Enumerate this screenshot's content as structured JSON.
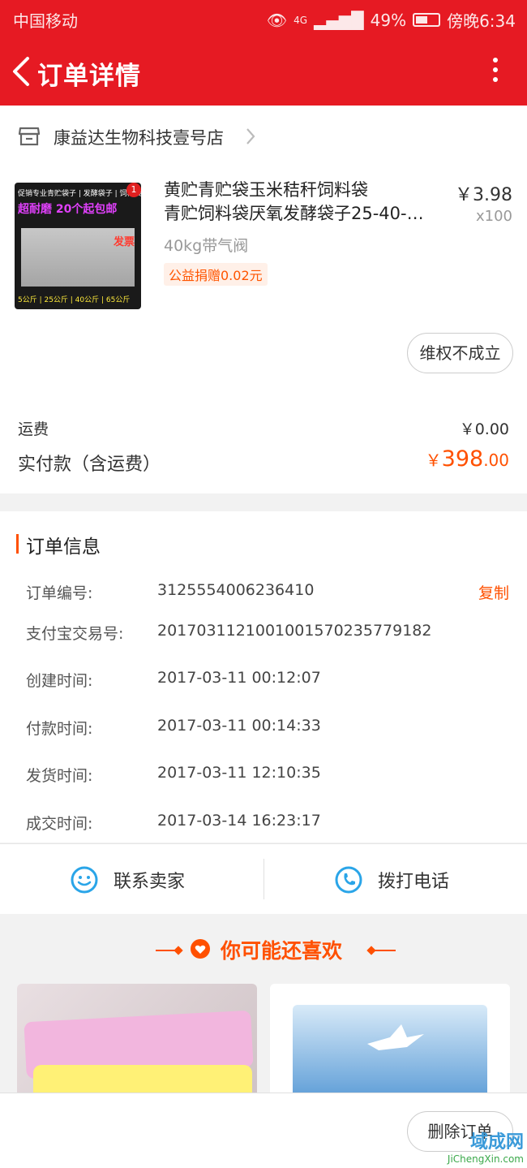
{
  "status_bar": {
    "carrier": "中国移动",
    "network": "4G",
    "battery": "49%",
    "time": "傍晚6:34"
  },
  "header": {
    "title": "订单详情"
  },
  "shop": {
    "name": "康益达生物科技壹号店"
  },
  "product": {
    "title_line1": "黄贮青贮袋玉米秸秆饲料袋",
    "title_line2": "青贮饲料袋厌氧发酵袋子25-40-…",
    "sku": "40kg带气阀",
    "charity_tag": "公益捐赠0.02元",
    "price": "￥3.98",
    "quantity": "x100",
    "image_text": {
      "top": "促销专业青贮袋子 | 发酵袋子 | 饲料袋",
      "promo": "超耐磨 20个起包邮",
      "invoice": "发票",
      "sizes": "5公斤 | 25公斤 | 40公斤 | 65公斤",
      "badge": "1"
    },
    "rights_button": "维权不成立"
  },
  "payment": {
    "freight_label": "运费",
    "freight_value": "￥0.00",
    "total_label": "实付款（含运费）",
    "total_currency": "￥",
    "total_int": "398",
    "total_dec": ".00"
  },
  "order_info": {
    "title": "订单信息",
    "copy_label": "复制",
    "rows": [
      {
        "label": "订单编号:",
        "value": "3125554006236410"
      },
      {
        "label": "支付宝交易号:",
        "value": "2017031121001001570235779182"
      },
      {
        "label": "创建时间:",
        "value": "2017-03-11 00:12:07"
      },
      {
        "label": "付款时间:",
        "value": "2017-03-11 00:14:33"
      },
      {
        "label": "发货时间:",
        "value": "2017-03-11 12:10:35"
      },
      {
        "label": "成交时间:",
        "value": "2017-03-14 16:23:17"
      }
    ]
  },
  "contact": {
    "seller": "联系卖家",
    "phone": "拨打电话"
  },
  "recommend": {
    "title": "你可能还喜欢"
  },
  "bottom": {
    "delete_button": "删除订单"
  },
  "watermark": {
    "main": "域成网",
    "sub": "JiChengXin.com"
  },
  "colors": {
    "brand_red": "#e61a23",
    "accent_orange": "#ff5000",
    "contact_blue": "#2aa5e8"
  }
}
